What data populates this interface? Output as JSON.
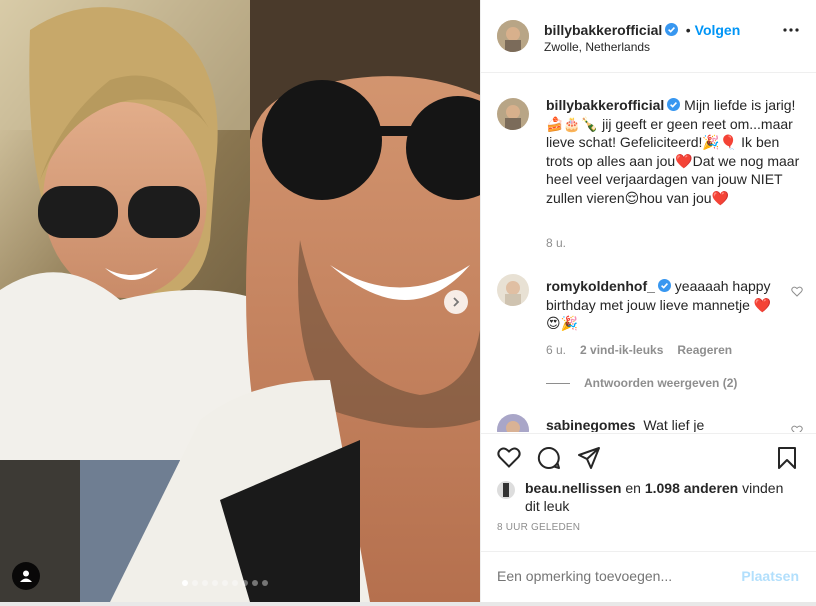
{
  "post": {
    "username": "billybakkerofficial",
    "follow_label": "Volgen",
    "separator": "•",
    "location": "Zwolle, Netherlands",
    "more_icon": "more-horizontal-icon",
    "caption": "Mijn liefde is jarig!🍰🎂🍾 jij geeft er geen reet om...maar lieve schat! Gefeliciteerd!🎉🎈 Ik ben trots op alles aan jou❤️Dat we nog maar heel veel verjaardagen van jouw NIET zullen vieren😌hou van jou❤️",
    "caption_time": "8 u."
  },
  "comments": [
    {
      "username": "romykoldenhof_",
      "text": "yeaaaah happy birthday met jouw lieve mannetje ❤️😍🎉",
      "time": "6 u.",
      "likes": "2 vind-ik-leuks",
      "reply_label": "Reageren",
      "view_replies": "Antwoorden weergeven (2)"
    },
    {
      "username": "sabinegomes",
      "text": "Wat lief je"
    }
  ],
  "likes": {
    "liker": "beau.nellissen",
    "conjunction": "en",
    "others": "1.098 anderen",
    "suffix": "vinden dit leuk"
  },
  "timestamp": "8 UUR GELEDEN",
  "add_comment": {
    "placeholder": "Een opmerking toevoegen...",
    "post_label": "Plaatsen"
  },
  "carousel": {
    "slide_count": 9,
    "active_index": 0
  },
  "colors": {
    "accent": "#0095f6",
    "verified": "#3897f0",
    "muted": "#8e8e8e",
    "post_disabled": "#b2dffc"
  }
}
